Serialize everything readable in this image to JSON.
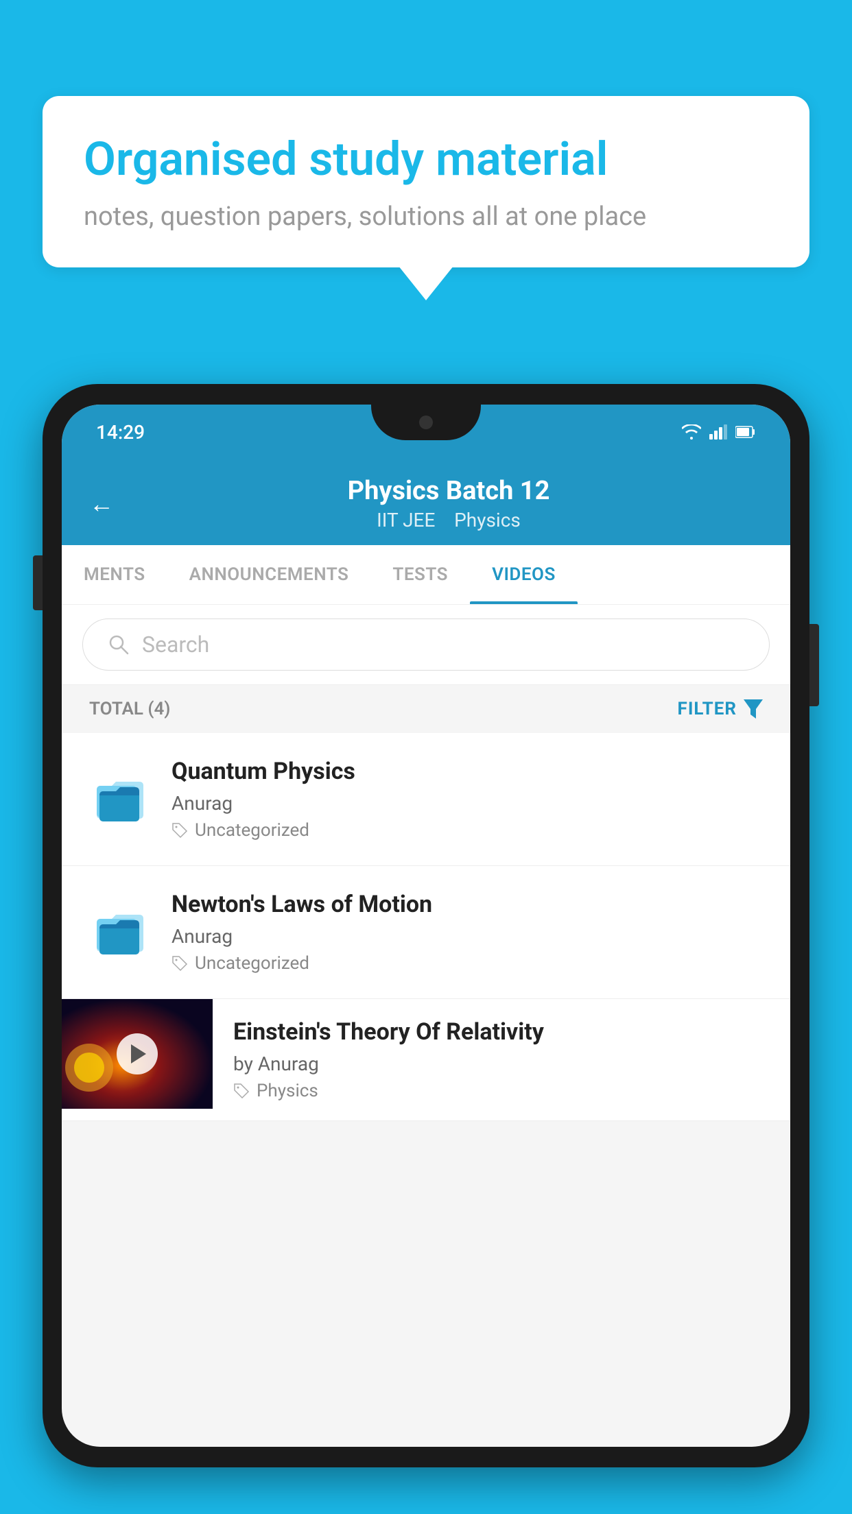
{
  "background_color": "#1ab8e8",
  "speech_bubble": {
    "title": "Organised study material",
    "subtitle": "notes, question papers, solutions all at one place"
  },
  "phone": {
    "status_bar": {
      "time": "14:29",
      "icons": [
        "wifi",
        "signal",
        "battery"
      ]
    },
    "header": {
      "back_label": "←",
      "title": "Physics Batch 12",
      "subtitle_part1": "IIT JEE",
      "subtitle_part2": "Physics"
    },
    "tabs": [
      {
        "label": "MENTS",
        "active": false
      },
      {
        "label": "ANNOUNCEMENTS",
        "active": false
      },
      {
        "label": "TESTS",
        "active": false
      },
      {
        "label": "VIDEOS",
        "active": true
      }
    ],
    "search": {
      "placeholder": "Search"
    },
    "filter_bar": {
      "total_label": "TOTAL (4)",
      "filter_label": "FILTER"
    },
    "list_items": [
      {
        "title": "Quantum Physics",
        "author": "Anurag",
        "tag": "Uncategorized",
        "type": "folder"
      },
      {
        "title": "Newton's Laws of Motion",
        "author": "Anurag",
        "tag": "Uncategorized",
        "type": "folder"
      },
      {
        "title": "Einstein's Theory Of Relativity",
        "author": "by Anurag",
        "tag": "Physics",
        "type": "video"
      }
    ]
  }
}
